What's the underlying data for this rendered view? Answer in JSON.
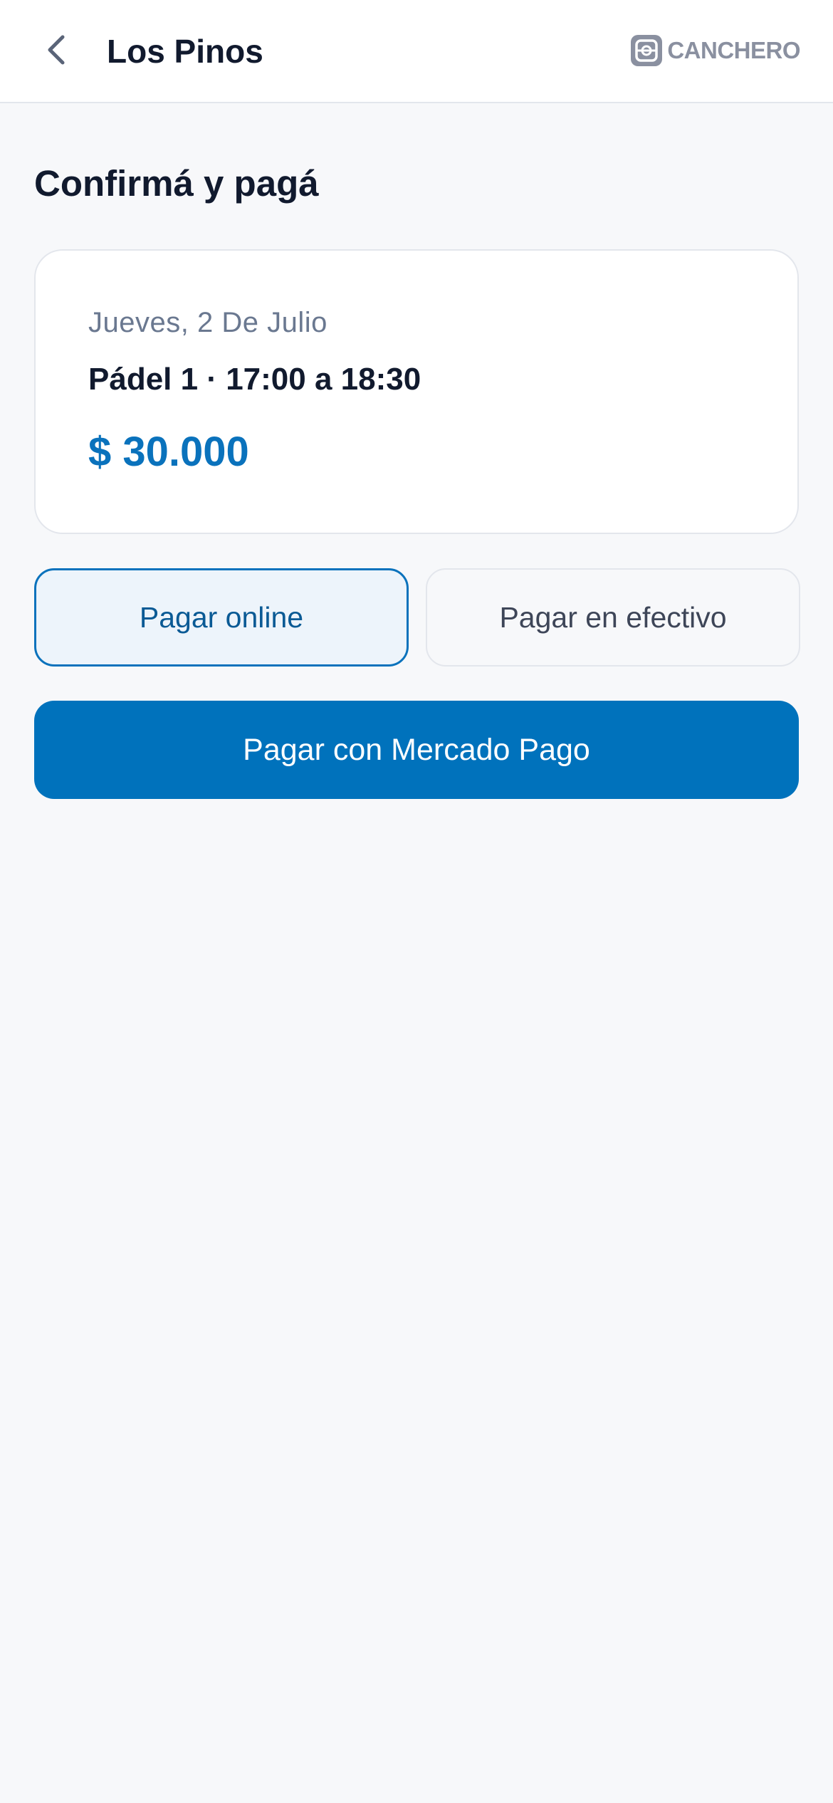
{
  "header": {
    "back_icon": "chevron-left-icon",
    "title": "Los Pinos",
    "brand_logo_icon": "canchero-logo-icon",
    "brand_name": "CANCHERO"
  },
  "page": {
    "heading": "Confirmá y pagá"
  },
  "summary": {
    "date": "Jueves, 2 De Julio",
    "slot": "Pádel 1 · 17:00 a 18:30",
    "price": "$ 30.000"
  },
  "payment_methods": {
    "selected": "online",
    "online_label": "Pagar online",
    "cash_label": "Pagar en efectivo"
  },
  "cta": {
    "label": "Pagar con Mercado Pago"
  },
  "colors": {
    "accent": "#0072bc",
    "text_primary": "#111a2e",
    "text_muted": "#6a7890",
    "background": "#f7f8fa",
    "selected_bg": "#edf4fb"
  }
}
